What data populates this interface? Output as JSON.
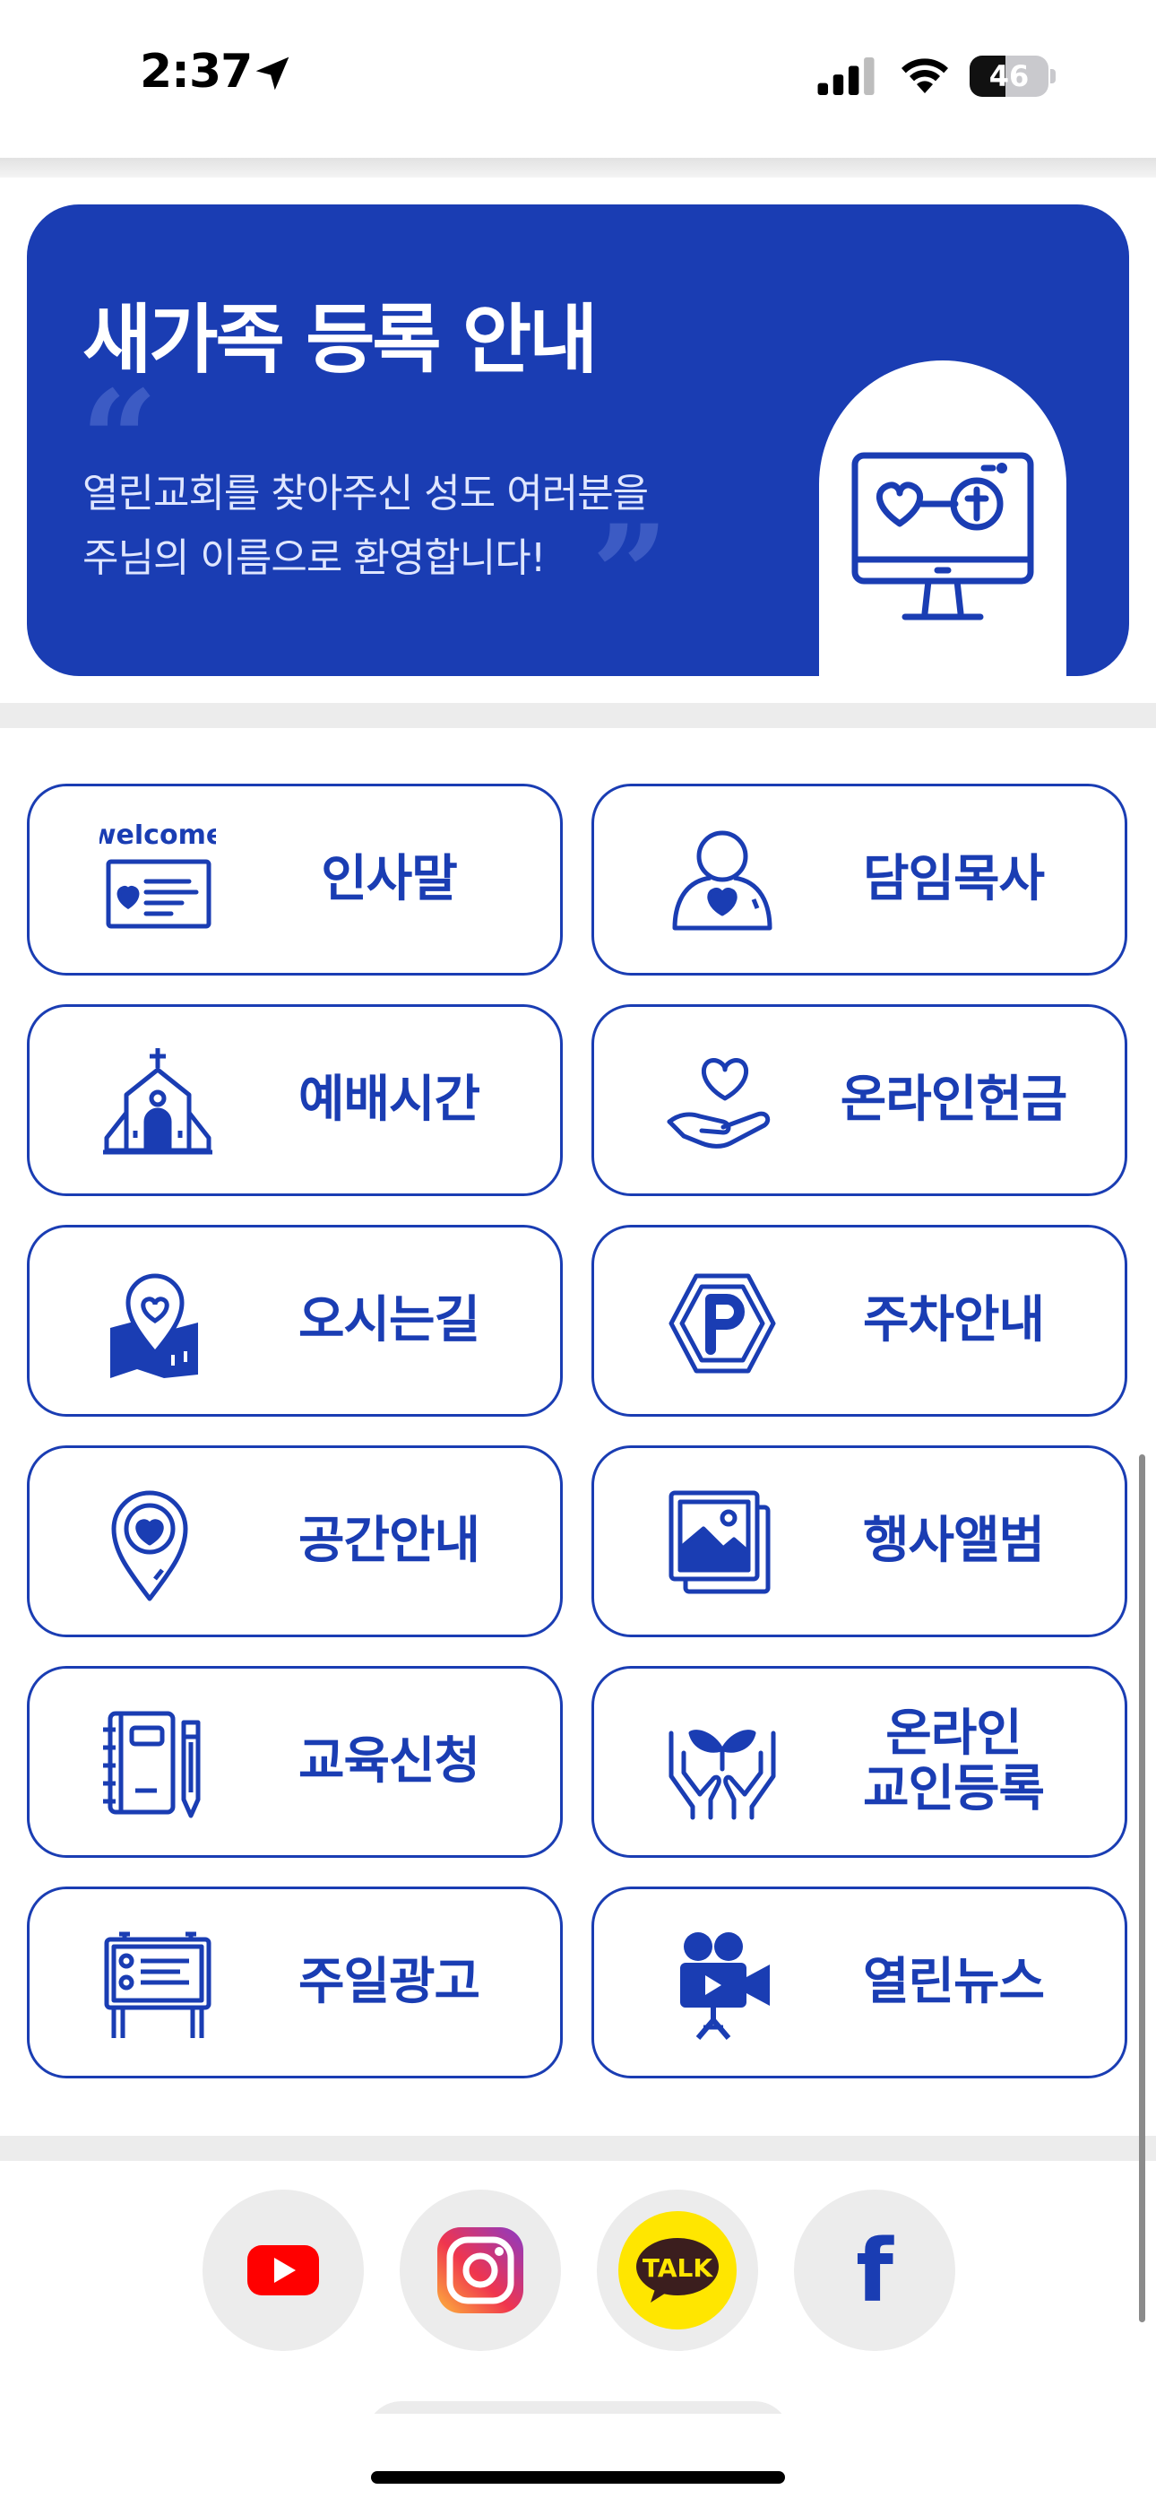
{
  "status_bar": {
    "time": "2:37",
    "battery_level": "46",
    "battery_fraction": 0.46
  },
  "banner": {
    "title": "새가족 등록 안내",
    "line1": "열린교회를 찾아주신 성도 여러분을",
    "line2": "주님의 이름으로 환영합니다!",
    "icon": "monitor-heart-cross-icon"
  },
  "menu": {
    "items": [
      {
        "label": "인사말",
        "icon": "welcome-card-icon",
        "icon_text": "welcome"
      },
      {
        "label": "담임목사",
        "icon": "pastor-person-icon"
      },
      {
        "label": "예배시간",
        "icon": "church-icon"
      },
      {
        "label": "온라인헌금",
        "icon": "hand-heart-icon"
      },
      {
        "label": "오시는길",
        "icon": "map-pin-icon"
      },
      {
        "label": "주차안내",
        "icon": "parking-icon"
      },
      {
        "label": "공간안내",
        "icon": "location-pin-heart-icon"
      },
      {
        "label": "행사앨범",
        "icon": "photo-album-icon"
      },
      {
        "label": "교육신청",
        "icon": "notebook-pencil-icon"
      },
      {
        "label": "온라인\n교인등록",
        "icon": "hands-sprout-icon"
      },
      {
        "label": "주일광고",
        "icon": "notice-board-icon"
      },
      {
        "label": "열린뉴스",
        "icon": "video-camera-icon"
      }
    ]
  },
  "socials": [
    {
      "name": "youtube",
      "icon": "youtube-icon"
    },
    {
      "name": "instagram",
      "icon": "instagram-icon"
    },
    {
      "name": "kakaotalk",
      "icon": "kakaotalk-icon",
      "text": "TALK"
    },
    {
      "name": "facebook",
      "icon": "facebook-icon",
      "text": "f"
    }
  ],
  "colors": {
    "primary": "#1a3db3",
    "divider": "#ececec",
    "youtube": "#ff0000",
    "kakao": "#ffe600",
    "facebook": "#1a3db3"
  }
}
